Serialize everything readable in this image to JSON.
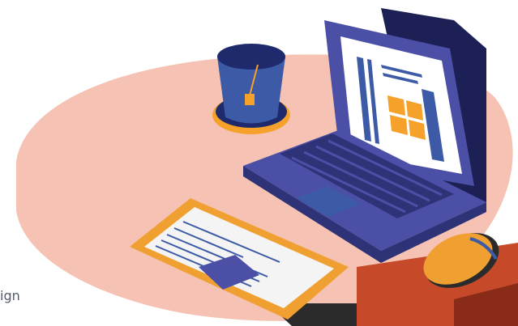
{
  "caption": {
    "text": "ign"
  },
  "colors": {
    "blob": "#f5c2b4",
    "laptop_body": "#4b4fa6",
    "laptop_dark": "#2e3277",
    "laptop_lid_back": "#1c2055",
    "screen": "#ffffff",
    "orange": "#f5a12a",
    "navy": "#1e2a6b",
    "cup": "#3c5aa6",
    "tablet_frame": "#f0a030",
    "tablet_screen": "#f4f4f4",
    "mouse": "#f0a030",
    "shadow": "#c64a2a",
    "dark_shadow": "#2b2b2b"
  },
  "icons": [
    "laptop-icon",
    "coffee-cup-icon",
    "tablet-icon",
    "mouse-icon"
  ]
}
